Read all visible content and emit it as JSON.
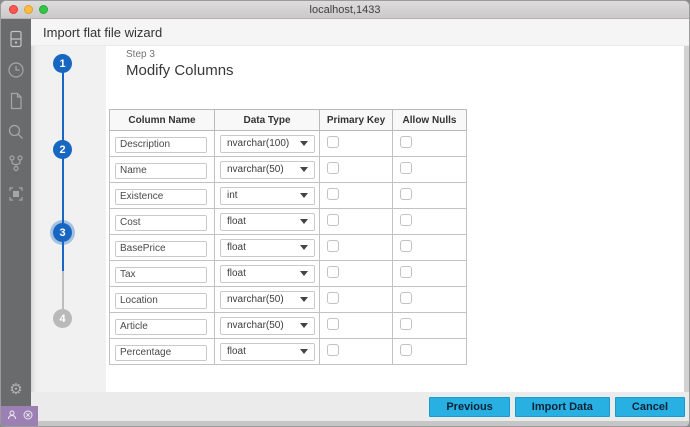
{
  "window": {
    "title": "localhost,1433"
  },
  "titlebar_buttons": {
    "close": "close",
    "minimize": "minimize",
    "zoom": "zoom"
  },
  "activity_bar": {
    "icons": [
      "servers-icon",
      "history-clock-icon",
      "file-icon",
      "search-icon",
      "source-control-icon",
      "extensions-icon"
    ],
    "settings_icon": "⚙"
  },
  "status_bar": {
    "icons": [
      "account-icon",
      "error-icon"
    ]
  },
  "wizard": {
    "title": "Import flat file wizard",
    "step_label": "Step 3",
    "page_title": "Modify Columns",
    "steps": [
      {
        "number": "1",
        "state": "done"
      },
      {
        "number": "2",
        "state": "done"
      },
      {
        "number": "3",
        "state": "current"
      },
      {
        "number": "4",
        "state": "upcoming"
      }
    ]
  },
  "table": {
    "headers": [
      "Column Name",
      "Data Type",
      "Primary Key",
      "Allow Nulls"
    ],
    "rows": [
      {
        "column_name": "Description",
        "data_type": "nvarchar(100)",
        "primary_key": false,
        "allow_nulls": false
      },
      {
        "column_name": "Name",
        "data_type": "nvarchar(50)",
        "primary_key": false,
        "allow_nulls": false
      },
      {
        "column_name": "Existence",
        "data_type": "int",
        "primary_key": false,
        "allow_nulls": false
      },
      {
        "column_name": "Cost",
        "data_type": "float",
        "primary_key": false,
        "allow_nulls": false
      },
      {
        "column_name": "BasePrice",
        "data_type": "float",
        "primary_key": false,
        "allow_nulls": false
      },
      {
        "column_name": "Tax",
        "data_type": "float",
        "primary_key": false,
        "allow_nulls": false
      },
      {
        "column_name": "Location",
        "data_type": "nvarchar(50)",
        "primary_key": false,
        "allow_nulls": false
      },
      {
        "column_name": "Article",
        "data_type": "nvarchar(50)",
        "primary_key": false,
        "allow_nulls": false
      },
      {
        "column_name": "Percentage",
        "data_type": "float",
        "primary_key": false,
        "allow_nulls": false
      }
    ]
  },
  "footer": {
    "previous_label": "Previous",
    "import_label": "Import Data",
    "cancel_label": "Cancel"
  },
  "colors": {
    "step_blue": "#1766c2",
    "button_cyan": "#29b0e2",
    "status_purple": "#9c80b4",
    "activity_bar_gray": "#6a6b6d"
  }
}
